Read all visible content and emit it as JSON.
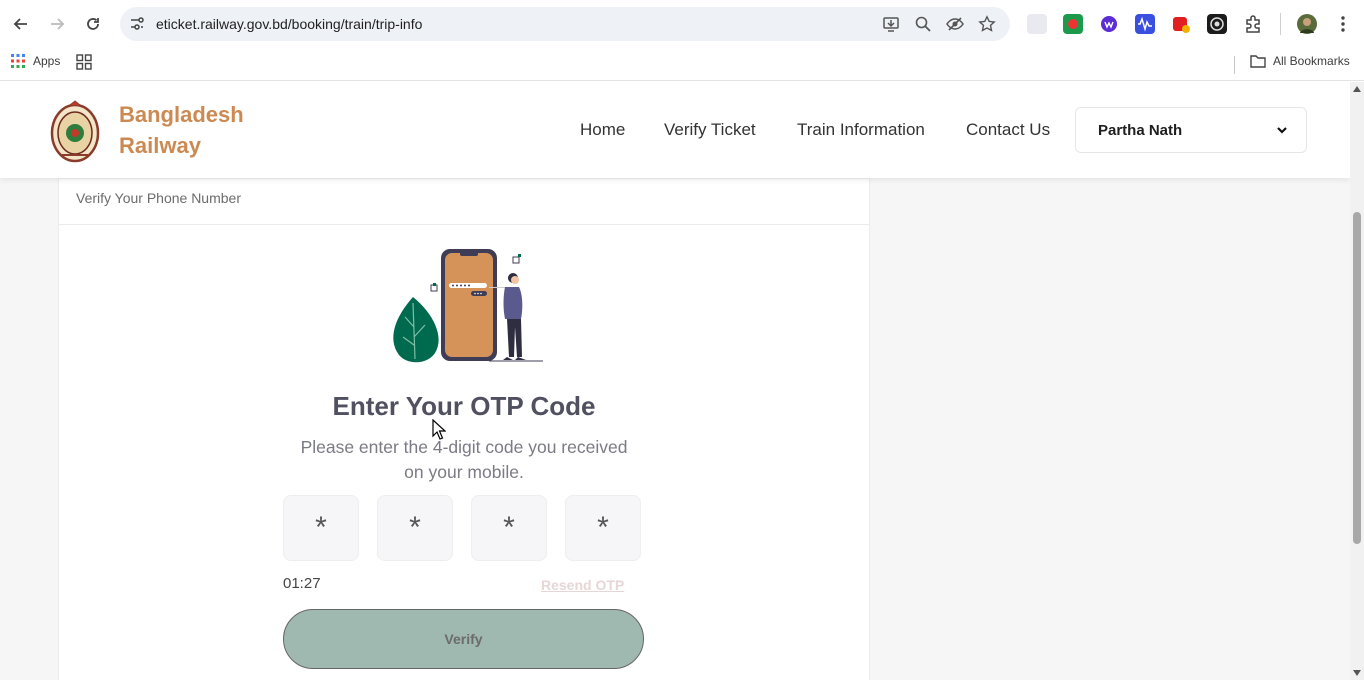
{
  "browser": {
    "url": "eticket.railway.gov.bd/booking/train/trip-info",
    "bookmarks": {
      "apps_label": "Apps",
      "all_bookmarks_label": "All Bookmarks"
    }
  },
  "site": {
    "brand_line1": "Bangladesh",
    "brand_line2": "Railway",
    "nav": {
      "home": "Home",
      "verify_ticket": "Verify Ticket",
      "train_information": "Train Information",
      "contact_us": "Contact Us"
    },
    "user_name": "Partha Nath"
  },
  "card": {
    "header": "Verify Your Phone Number",
    "title": "Enter Your OTP Code",
    "subtitle": "Please enter the 4-digit code you received on your mobile.",
    "otp_digits": [
      "*",
      "*",
      "*",
      "*"
    ],
    "timer": "01:27",
    "resend_label": "Resend OTP",
    "verify_label": "Verify"
  },
  "colors": {
    "brand": "#cc8a52",
    "accent": "#006a4e",
    "verify_bg": "#9fb9b0"
  }
}
